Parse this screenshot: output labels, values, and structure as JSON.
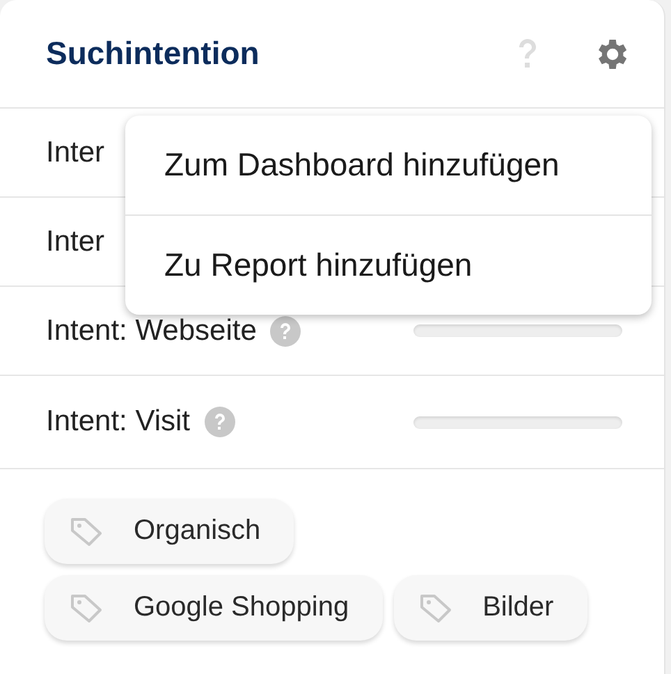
{
  "card": {
    "title": "Suchintention"
  },
  "rows": [
    {
      "label": "Inter"
    },
    {
      "label": "Inter"
    },
    {
      "label": "Intent: Webseite",
      "help_icon": true,
      "level": 0
    },
    {
      "label": "Intent: Visit",
      "help_icon": true,
      "level": 0
    }
  ],
  "menu": {
    "items": [
      "Zum Dashboard hinzufügen",
      "Zu Report hinzufügen"
    ]
  },
  "tags": [
    "Organisch",
    "Google Shopping",
    "Bilder"
  ]
}
